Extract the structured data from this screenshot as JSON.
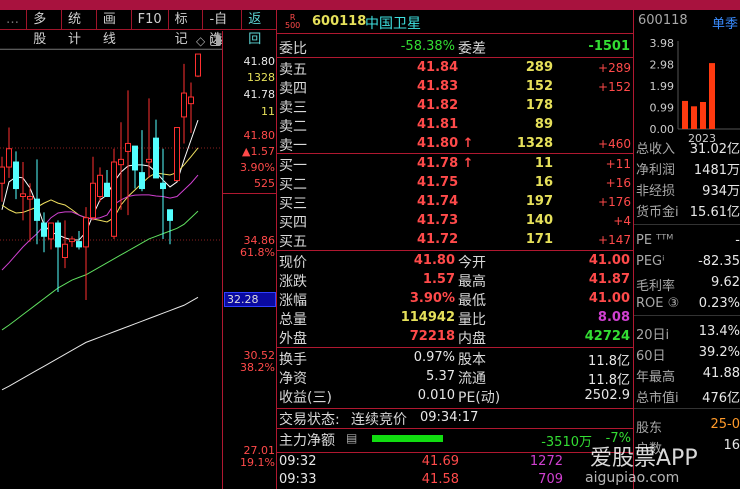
{
  "toolbar": {
    "items": [
      "多股",
      "统计",
      "画线",
      "F10",
      "标记",
      "-自选",
      "返回"
    ]
  },
  "axis": {
    "ask_price": "41.80",
    "ask_vol": "1328",
    "bid_price": "41.78",
    "bid_vol": "11",
    "last": "41.80",
    "change": "▲1.57",
    "pct": "3.90%",
    "vol": "525",
    "fib1_price": "34.86",
    "fib1_pct": "61.8%",
    "cursor_price": "32.28",
    "fib2_price": "30.52",
    "fib2_pct": "38.2%",
    "fib3_price": "27.01",
    "fib3_pct": "19.1%"
  },
  "chart_data": {
    "type": "candlestick",
    "ylim": [
      26.5,
      42.0
    ],
    "candles": [
      [
        37.0,
        38.0,
        36.3,
        37.61
      ],
      [
        37.61,
        39.1,
        37.2,
        38.3
      ],
      [
        37.8,
        38.2,
        36.4,
        36.8
      ],
      [
        36.5,
        37.8,
        35.6,
        36.6
      ],
      [
        36.4,
        37.0,
        34.8,
        36.5
      ],
      [
        36.4,
        37.9,
        34.7,
        35.6
      ],
      [
        35.5,
        35.9,
        34.4,
        35.0
      ],
      [
        34.9,
        35.4,
        34.5,
        35.5
      ],
      [
        35.5,
        35.6,
        32.9,
        34.6
      ],
      [
        34.2,
        35.6,
        33.8,
        34.7
      ],
      [
        34.8,
        35.0,
        34.6,
        34.9
      ],
      [
        34.8,
        35.2,
        34.5,
        34.6
      ],
      [
        34.6,
        36.1,
        32.6,
        35.7
      ],
      [
        35.7,
        38.0,
        35.6,
        37.0
      ],
      [
        36.5,
        37.6,
        36.3,
        37.3
      ],
      [
        37.0,
        37.5,
        36.5,
        36.5
      ],
      [
        35.0,
        38.3,
        34.9,
        37.8
      ],
      [
        37.7,
        39.3,
        36.0,
        37.9
      ],
      [
        38.2,
        40.5,
        35.8,
        38.5
      ],
      [
        38.4,
        38.4,
        36.8,
        37.5
      ],
      [
        37.4,
        39.0,
        36.7,
        36.8
      ],
      [
        37.8,
        40.2,
        37.2,
        37.9
      ],
      [
        38.7,
        39.4,
        37.3,
        37.2
      ],
      [
        37.0,
        38.3,
        34.9,
        36.8
      ],
      [
        36.0,
        36.0,
        34.7,
        35.6
      ],
      [
        37.1,
        39.1,
        37.1,
        39.1
      ],
      [
        39.5,
        41.5,
        38.5,
        40.4
      ],
      [
        40.0,
        40.8,
        38.9,
        40.25
      ],
      [
        41.04,
        41.87,
        41.0,
        41.87
      ]
    ],
    "ma": [
      {
        "name": "MA5",
        "color": "#ffffff",
        "values": [
          36.0,
          37.05,
          37.24,
          37.2,
          36.82,
          36.18,
          35.43,
          35.16,
          35.05,
          34.94,
          34.86,
          34.86,
          35.16,
          35.8,
          36.37,
          36.56,
          37.05,
          37.42,
          37.65,
          37.69,
          37.69,
          37.65,
          37.42,
          37.12,
          36.86,
          37.05,
          37.88,
          38.63,
          39.38
        ]
      },
      {
        "name": "MA10",
        "color": "#f0e060",
        "values": [
          36.18,
          36.0,
          35.88,
          35.9,
          36.0,
          36.1,
          36.25,
          36.37,
          36.25,
          36.18,
          36.0,
          35.8,
          35.7,
          35.65,
          35.6,
          35.54,
          35.7,
          36.18,
          36.5,
          36.75,
          37.0,
          37.24,
          37.39,
          37.35,
          37.31,
          37.4,
          37.69,
          38.0,
          38.33
        ]
      },
      {
        "name": "MA20",
        "color": "#d040d0",
        "values": [
          33.73,
          34.0,
          34.3,
          34.6,
          34.86,
          35.1,
          35.4,
          35.7,
          35.88,
          35.92,
          35.92,
          35.8,
          35.69,
          35.65,
          35.7,
          35.8,
          36.2,
          36.37,
          36.5,
          36.55,
          36.56,
          36.56,
          36.52,
          36.5,
          36.44,
          36.5,
          36.75,
          37.0,
          37.31
        ]
      },
      {
        "name": "MA60",
        "color": "#60e060",
        "values": [
          31.47,
          31.65,
          31.85,
          32.05,
          32.25,
          32.45,
          32.65,
          32.85,
          33.05,
          33.2,
          33.35,
          33.45,
          33.55,
          33.7,
          33.85,
          34.0,
          34.15,
          34.3,
          34.45,
          34.6,
          34.75,
          34.9,
          35.0,
          35.1,
          35.2,
          35.3,
          35.45,
          35.7,
          35.95
        ]
      },
      {
        "name": "MA120",
        "color": "#e8e8e8",
        "values": [
          29.21,
          29.35,
          29.5,
          29.65,
          29.8,
          29.95,
          30.1,
          30.25,
          30.4,
          30.55,
          30.7,
          30.85,
          31.0,
          31.1,
          31.2,
          31.3,
          31.4,
          31.5,
          31.6,
          31.7,
          31.8,
          31.9,
          32.0,
          32.1,
          32.2,
          32.3,
          32.4,
          32.55,
          32.7
        ]
      }
    ]
  },
  "quote": {
    "badge_top": "R",
    "badge_bottom": "500",
    "code": "600118",
    "name": "中国卫星",
    "weibi_label": "委比",
    "weibi": "-58.38%",
    "weicha_label": "委差",
    "weicha": "-1501",
    "asks": [
      {
        "label": "卖五",
        "price": "41.84",
        "vol": "289",
        "chg": "+289"
      },
      {
        "label": "卖四",
        "price": "41.83",
        "vol": "152",
        "chg": "+152"
      },
      {
        "label": "卖三",
        "price": "41.82",
        "vol": "178",
        "chg": ""
      },
      {
        "label": "卖二",
        "price": "41.81",
        "vol": "89",
        "chg": ""
      },
      {
        "label": "卖一",
        "price": "41.80 ↑",
        "vol": "1328",
        "chg": "+460"
      }
    ],
    "bids": [
      {
        "label": "买一",
        "price": "41.78 ↑",
        "vol": "11",
        "chg": "+11"
      },
      {
        "label": "买二",
        "price": "41.75",
        "vol": "16",
        "chg": "+16"
      },
      {
        "label": "买三",
        "price": "41.74",
        "vol": "197",
        "chg": "+176"
      },
      {
        "label": "买四",
        "price": "41.73",
        "vol": "140",
        "chg": "+4"
      },
      {
        "label": "买五",
        "price": "41.72",
        "vol": "171",
        "chg": "+147"
      }
    ],
    "stats": [
      {
        "l1": "现价",
        "v1": "41.80",
        "c1": "red",
        "l2": "今开",
        "v2": "41.00",
        "c2": "red"
      },
      {
        "l1": "涨跌",
        "v1": "1.57",
        "c1": "red",
        "l2": "最高",
        "v2": "41.87",
        "c2": "red"
      },
      {
        "l1": "涨幅",
        "v1": "3.90%",
        "c1": "red",
        "l2": "最低",
        "v2": "41.00",
        "c2": "red"
      },
      {
        "l1": "总量",
        "v1": "114942",
        "c1": "yel",
        "l2": "量比",
        "v2": "8.08",
        "c2": "mag"
      },
      {
        "l1": "外盘",
        "v1": "72218",
        "c1": "red",
        "l2": "内盘",
        "v2": "42724",
        "c2": "grn"
      }
    ],
    "fund": [
      {
        "l1": "换手",
        "v1": "0.97%",
        "l2": "股本",
        "v2": "11.8亿"
      },
      {
        "l1": "净资",
        "v1": "5.37",
        "l2": "流通",
        "v2": "11.8亿"
      },
      {
        "l1": "收益(三)",
        "v1": "0.010",
        "l2": "PE(动)",
        "v2": "2502.9"
      }
    ],
    "status_label": "交易状态:",
    "status": "连续竞价",
    "status_time": "09:34:17",
    "main_flow_label": "主力净额",
    "main_flow": "-3510万",
    "main_flow_pct": "-7%",
    "main_flow_fill": 0.75,
    "ticks": [
      {
        "time": "09:32",
        "price": "41.69",
        "vol": "1272"
      },
      {
        "time": "09:33",
        "price": "41.58",
        "vol": "709"
      }
    ]
  },
  "side": {
    "code": "600118",
    "tab": "单季",
    "bar_ticks": [
      "3.98",
      "2.98",
      "1.99",
      "0.99",
      "0.00"
    ],
    "bar_year": "2023",
    "bars": [
      1.3,
      1.05,
      1.25,
      3.05
    ],
    "bar_max": 3.98,
    "rows1": [
      {
        "l": "总收入",
        "v": "31.02亿"
      },
      {
        "l": "净利润",
        "v": "1481万"
      },
      {
        "l": "非经损",
        "v": "934万"
      },
      {
        "l": "货币金i",
        "v": "15.61亿"
      }
    ],
    "rows2": [
      {
        "l": "PE ᵀᵀᴹ",
        "v": "-"
      },
      {
        "l": "PEGⁱ",
        "v": "-82.35"
      },
      {
        "l": "毛利率",
        "v": "9.62"
      },
      {
        "l": "ROE ③",
        "v": "0.23%"
      }
    ],
    "rows3": [
      {
        "l": "20日i",
        "v": "13.4%"
      },
      {
        "l": "60日",
        "v": "39.2%"
      },
      {
        "l": "年最高",
        "v": "41.88"
      },
      {
        "l": "总市值i",
        "v": "476亿"
      }
    ],
    "rows4": [
      {
        "l": "股东",
        "v": "25-0"
      },
      {
        "l": "户数",
        "v": "16"
      }
    ]
  },
  "watermark": {
    "brand": "爱股票APP",
    "site": "aigupiao.com"
  }
}
